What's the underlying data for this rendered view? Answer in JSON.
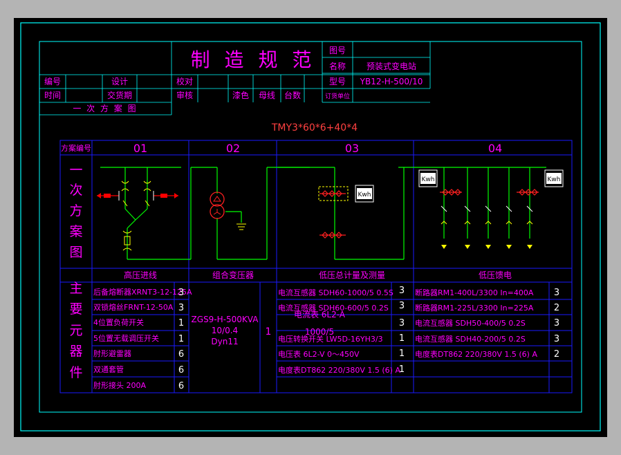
{
  "colors": {
    "background": "#000000",
    "border": "#00ffff",
    "table_line": "#ffff00",
    "grid_line": "#1a1aff",
    "magenta": "#ff00ff",
    "red_text": "#ff4040",
    "green_wire": "#00ff00",
    "white": "#ffffff",
    "yellow": "#ffff00"
  },
  "title_block": {
    "title": "制 造 规 范",
    "labels": {
      "tuhao": "图号",
      "mingcheng": "名称",
      "xinghao": "型号",
      "bianhao": "编号",
      "sheji": "设计",
      "jiaodui": "校对",
      "shijian": "时间",
      "jiaohuoqi": "交货期",
      "shenhe": "审核",
      "qise": "漆色",
      "muxian": "母线",
      "taishu": "台数",
      "dinghuo": "订货单位",
      "scheme_caption": "一 次 方 案 图"
    },
    "values": {
      "mingcheng": "预装式变电站",
      "xinghao": "YB12-H-500/10"
    }
  },
  "busbar_label": "TMY3*60*6+40*4",
  "scheme": {
    "header_label": "方案编号",
    "columns": [
      "01",
      "02",
      "03",
      "04"
    ],
    "diagram_side_label": [
      "一",
      "次",
      "方",
      "案",
      "图"
    ],
    "component_side_label": [
      "主",
      "要",
      "元",
      "器",
      "件"
    ],
    "section_titles": [
      "高压进线",
      "组合变压器",
      "低压总计量及测量",
      "低压馈电"
    ],
    "kwh_label": "Kwh"
  },
  "components": {
    "col01": [
      {
        "name": "后备熔断器XRNT3-12-125A",
        "qty": "3"
      },
      {
        "name": "双锁熔丝FRNT-12-50A",
        "qty": "3"
      },
      {
        "name": "4位置负荷开关",
        "qty": "1"
      },
      {
        "name": "5位置无载调压开关",
        "qty": "1"
      },
      {
        "name": "肘形避雷器",
        "qty": "6"
      },
      {
        "name": "双通套管",
        "qty": "6"
      },
      {
        "name": "肘形接头 200A",
        "qty": "6"
      }
    ],
    "col02": {
      "lines": [
        "ZGS9-H-500KVA",
        "10/0.4",
        "Dyn11"
      ],
      "qty": "1"
    },
    "col03": [
      {
        "name": "电流互感器 SDH60-1000/5 0.5S",
        "qty": "3"
      },
      {
        "name": "电流互感器 SDH60-600/5 0.2S",
        "qty": "3"
      },
      {
        "name": "",
        "qty": "3"
      },
      {
        "name": "电压转换开关 LW5D-16YH3/3",
        "qty": "1"
      },
      {
        "name": "电压表 6L2-V 0～450V",
        "qty": "1"
      },
      {
        "name": "电度表DT862 220/380V 1.5 (6) A",
        "qty": "1"
      }
    ],
    "col03_overlay": [
      "电流表 6L2-A",
      "1000/5"
    ],
    "col04": [
      {
        "name": "断路器RM1-400L/3300  In=400A",
        "qty": "3"
      },
      {
        "name": "断路器RM1-225L/3300  In=225A",
        "qty": "2"
      },
      {
        "name": "电流互感器 SDH50-400/5 0.2S",
        "qty": "3"
      },
      {
        "name": "电流互感器 SDH40-200/5 0.2S",
        "qty": "3"
      },
      {
        "name": "电度表DT862 220/380V 1.5 (6) A",
        "qty": "2"
      }
    ]
  }
}
